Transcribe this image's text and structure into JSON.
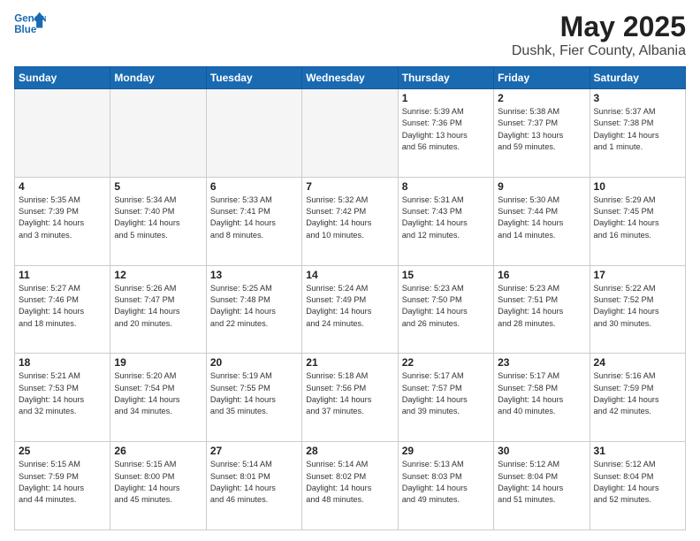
{
  "logo": {
    "line1": "General",
    "line2": "Blue"
  },
  "title": "May 2025",
  "subtitle": "Dushk, Fier County, Albania",
  "days_of_week": [
    "Sunday",
    "Monday",
    "Tuesday",
    "Wednesday",
    "Thursday",
    "Friday",
    "Saturday"
  ],
  "weeks": [
    [
      {
        "day": "",
        "info": ""
      },
      {
        "day": "",
        "info": ""
      },
      {
        "day": "",
        "info": ""
      },
      {
        "day": "",
        "info": ""
      },
      {
        "day": "1",
        "info": "Sunrise: 5:39 AM\nSunset: 7:36 PM\nDaylight: 13 hours\nand 56 minutes."
      },
      {
        "day": "2",
        "info": "Sunrise: 5:38 AM\nSunset: 7:37 PM\nDaylight: 13 hours\nand 59 minutes."
      },
      {
        "day": "3",
        "info": "Sunrise: 5:37 AM\nSunset: 7:38 PM\nDaylight: 14 hours\nand 1 minute."
      }
    ],
    [
      {
        "day": "4",
        "info": "Sunrise: 5:35 AM\nSunset: 7:39 PM\nDaylight: 14 hours\nand 3 minutes."
      },
      {
        "day": "5",
        "info": "Sunrise: 5:34 AM\nSunset: 7:40 PM\nDaylight: 14 hours\nand 5 minutes."
      },
      {
        "day": "6",
        "info": "Sunrise: 5:33 AM\nSunset: 7:41 PM\nDaylight: 14 hours\nand 8 minutes."
      },
      {
        "day": "7",
        "info": "Sunrise: 5:32 AM\nSunset: 7:42 PM\nDaylight: 14 hours\nand 10 minutes."
      },
      {
        "day": "8",
        "info": "Sunrise: 5:31 AM\nSunset: 7:43 PM\nDaylight: 14 hours\nand 12 minutes."
      },
      {
        "day": "9",
        "info": "Sunrise: 5:30 AM\nSunset: 7:44 PM\nDaylight: 14 hours\nand 14 minutes."
      },
      {
        "day": "10",
        "info": "Sunrise: 5:29 AM\nSunset: 7:45 PM\nDaylight: 14 hours\nand 16 minutes."
      }
    ],
    [
      {
        "day": "11",
        "info": "Sunrise: 5:27 AM\nSunset: 7:46 PM\nDaylight: 14 hours\nand 18 minutes."
      },
      {
        "day": "12",
        "info": "Sunrise: 5:26 AM\nSunset: 7:47 PM\nDaylight: 14 hours\nand 20 minutes."
      },
      {
        "day": "13",
        "info": "Sunrise: 5:25 AM\nSunset: 7:48 PM\nDaylight: 14 hours\nand 22 minutes."
      },
      {
        "day": "14",
        "info": "Sunrise: 5:24 AM\nSunset: 7:49 PM\nDaylight: 14 hours\nand 24 minutes."
      },
      {
        "day": "15",
        "info": "Sunrise: 5:23 AM\nSunset: 7:50 PM\nDaylight: 14 hours\nand 26 minutes."
      },
      {
        "day": "16",
        "info": "Sunrise: 5:23 AM\nSunset: 7:51 PM\nDaylight: 14 hours\nand 28 minutes."
      },
      {
        "day": "17",
        "info": "Sunrise: 5:22 AM\nSunset: 7:52 PM\nDaylight: 14 hours\nand 30 minutes."
      }
    ],
    [
      {
        "day": "18",
        "info": "Sunrise: 5:21 AM\nSunset: 7:53 PM\nDaylight: 14 hours\nand 32 minutes."
      },
      {
        "day": "19",
        "info": "Sunrise: 5:20 AM\nSunset: 7:54 PM\nDaylight: 14 hours\nand 34 minutes."
      },
      {
        "day": "20",
        "info": "Sunrise: 5:19 AM\nSunset: 7:55 PM\nDaylight: 14 hours\nand 35 minutes."
      },
      {
        "day": "21",
        "info": "Sunrise: 5:18 AM\nSunset: 7:56 PM\nDaylight: 14 hours\nand 37 minutes."
      },
      {
        "day": "22",
        "info": "Sunrise: 5:17 AM\nSunset: 7:57 PM\nDaylight: 14 hours\nand 39 minutes."
      },
      {
        "day": "23",
        "info": "Sunrise: 5:17 AM\nSunset: 7:58 PM\nDaylight: 14 hours\nand 40 minutes."
      },
      {
        "day": "24",
        "info": "Sunrise: 5:16 AM\nSunset: 7:59 PM\nDaylight: 14 hours\nand 42 minutes."
      }
    ],
    [
      {
        "day": "25",
        "info": "Sunrise: 5:15 AM\nSunset: 7:59 PM\nDaylight: 14 hours\nand 44 minutes."
      },
      {
        "day": "26",
        "info": "Sunrise: 5:15 AM\nSunset: 8:00 PM\nDaylight: 14 hours\nand 45 minutes."
      },
      {
        "day": "27",
        "info": "Sunrise: 5:14 AM\nSunset: 8:01 PM\nDaylight: 14 hours\nand 46 minutes."
      },
      {
        "day": "28",
        "info": "Sunrise: 5:14 AM\nSunset: 8:02 PM\nDaylight: 14 hours\nand 48 minutes."
      },
      {
        "day": "29",
        "info": "Sunrise: 5:13 AM\nSunset: 8:03 PM\nDaylight: 14 hours\nand 49 minutes."
      },
      {
        "day": "30",
        "info": "Sunrise: 5:12 AM\nSunset: 8:04 PM\nDaylight: 14 hours\nand 51 minutes."
      },
      {
        "day": "31",
        "info": "Sunrise: 5:12 AM\nSunset: 8:04 PM\nDaylight: 14 hours\nand 52 minutes."
      }
    ]
  ]
}
